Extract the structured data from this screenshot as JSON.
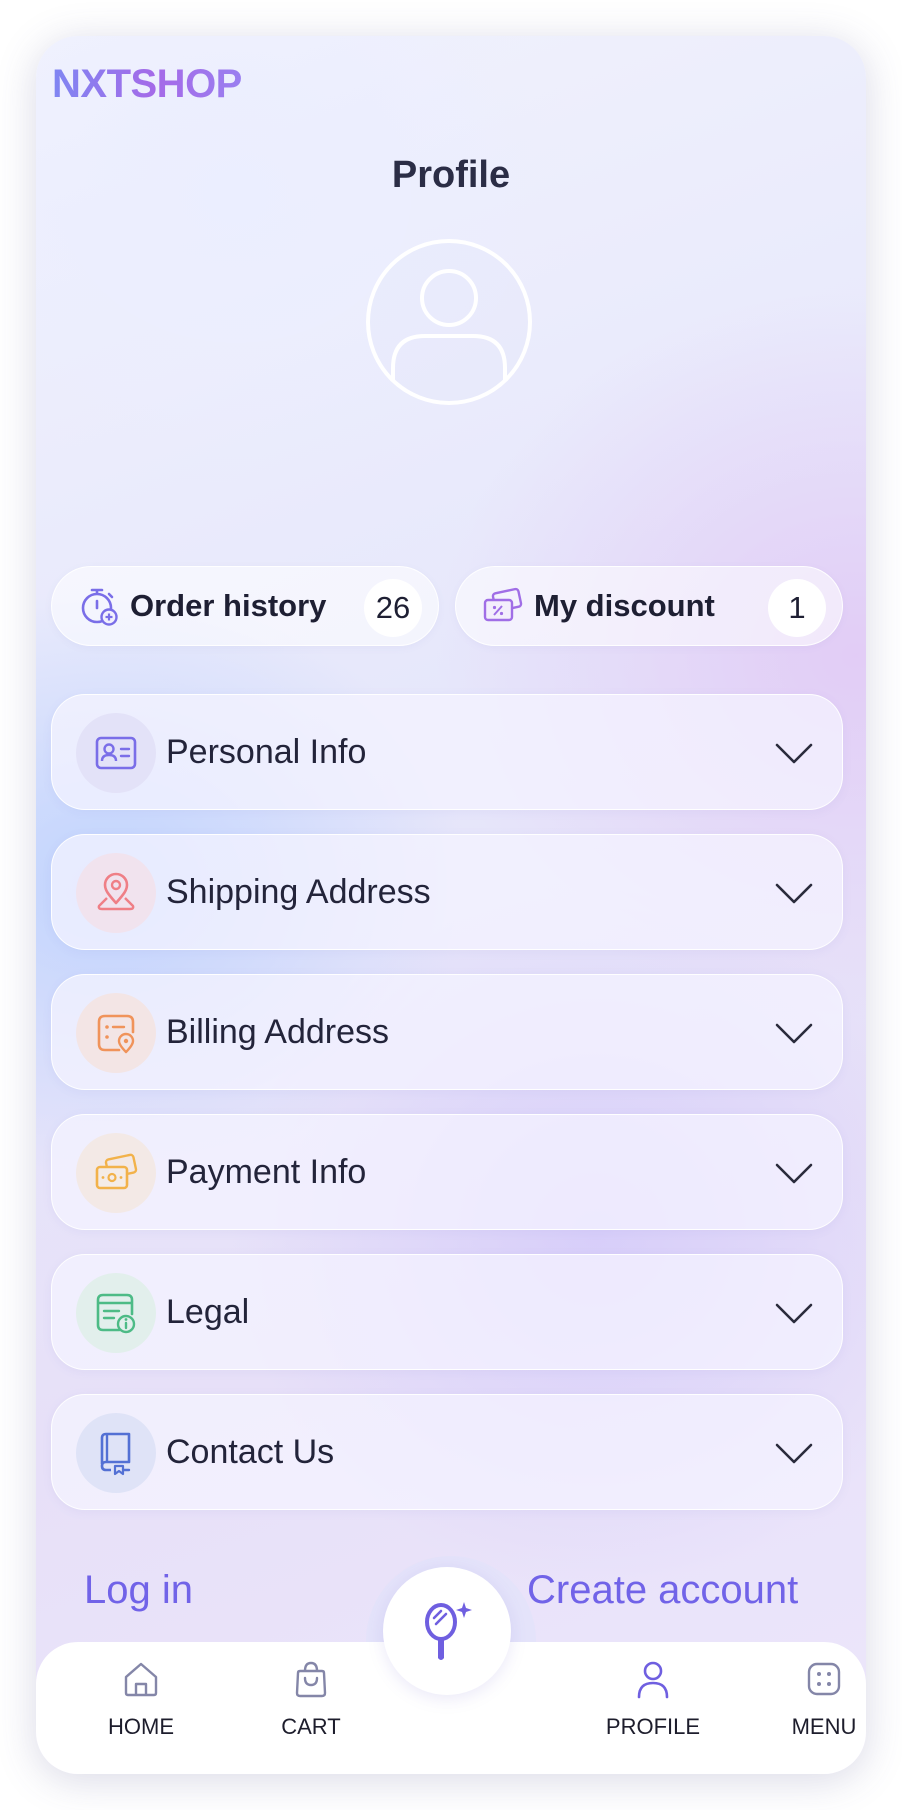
{
  "brand": {
    "logo": "NXTSHOP"
  },
  "header": {
    "title": "Profile"
  },
  "stats": {
    "order_history": {
      "label": "Order history",
      "count": "26",
      "icon": "timer-plus-icon"
    },
    "my_discount": {
      "label": "My discount",
      "count": "1",
      "icon": "discount-ticket-icon"
    }
  },
  "sections": [
    {
      "label": "Personal Info",
      "icon": "id-card-icon",
      "color": "#7a6ee8",
      "bg": "#e2e2f8"
    },
    {
      "label": "Shipping Address",
      "icon": "location-pin-icon",
      "color": "#ef7f86",
      "bg": "#f3e3ee"
    },
    {
      "label": "Billing Address",
      "icon": "billing-location-icon",
      "color": "#f0935a",
      "bg": "#f4e5e6"
    },
    {
      "label": "Payment Info",
      "icon": "wallet-icon",
      "color": "#f2b24a",
      "bg": "#f4ebe8"
    },
    {
      "label": "Legal",
      "icon": "legal-document-icon",
      "color": "#4dbb86",
      "bg": "#e3f1ee"
    },
    {
      "label": "Contact Us",
      "icon": "contact-book-icon",
      "color": "#5370d4",
      "bg": "#e0e4f8"
    }
  ],
  "auth": {
    "login": "Log in",
    "create_account": "Create account"
  },
  "nav": {
    "home": "HOME",
    "cart": "CART",
    "profile": "PROFILE",
    "menu": "MENU",
    "center_action_icon": "magic-mirror-icon",
    "active": "PROFILE"
  },
  "colors": {
    "accent": "#7163e8",
    "text": "#23243a"
  }
}
